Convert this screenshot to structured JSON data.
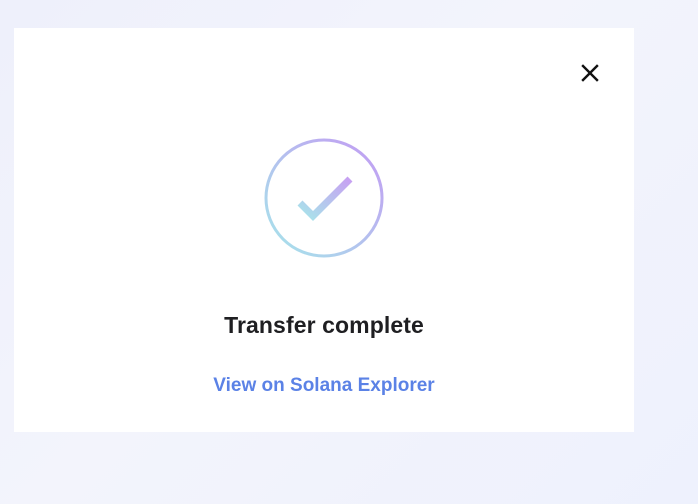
{
  "modal": {
    "title": "Transfer complete",
    "link_label": "View on Solana Explorer",
    "close_icon": "close-icon",
    "status_icon": "checkmark-circle-icon"
  },
  "colors": {
    "link": "#5b82e6",
    "title": "#1f1f22",
    "gradient_start": "#c39af3",
    "gradient_end": "#a6e6ea"
  }
}
